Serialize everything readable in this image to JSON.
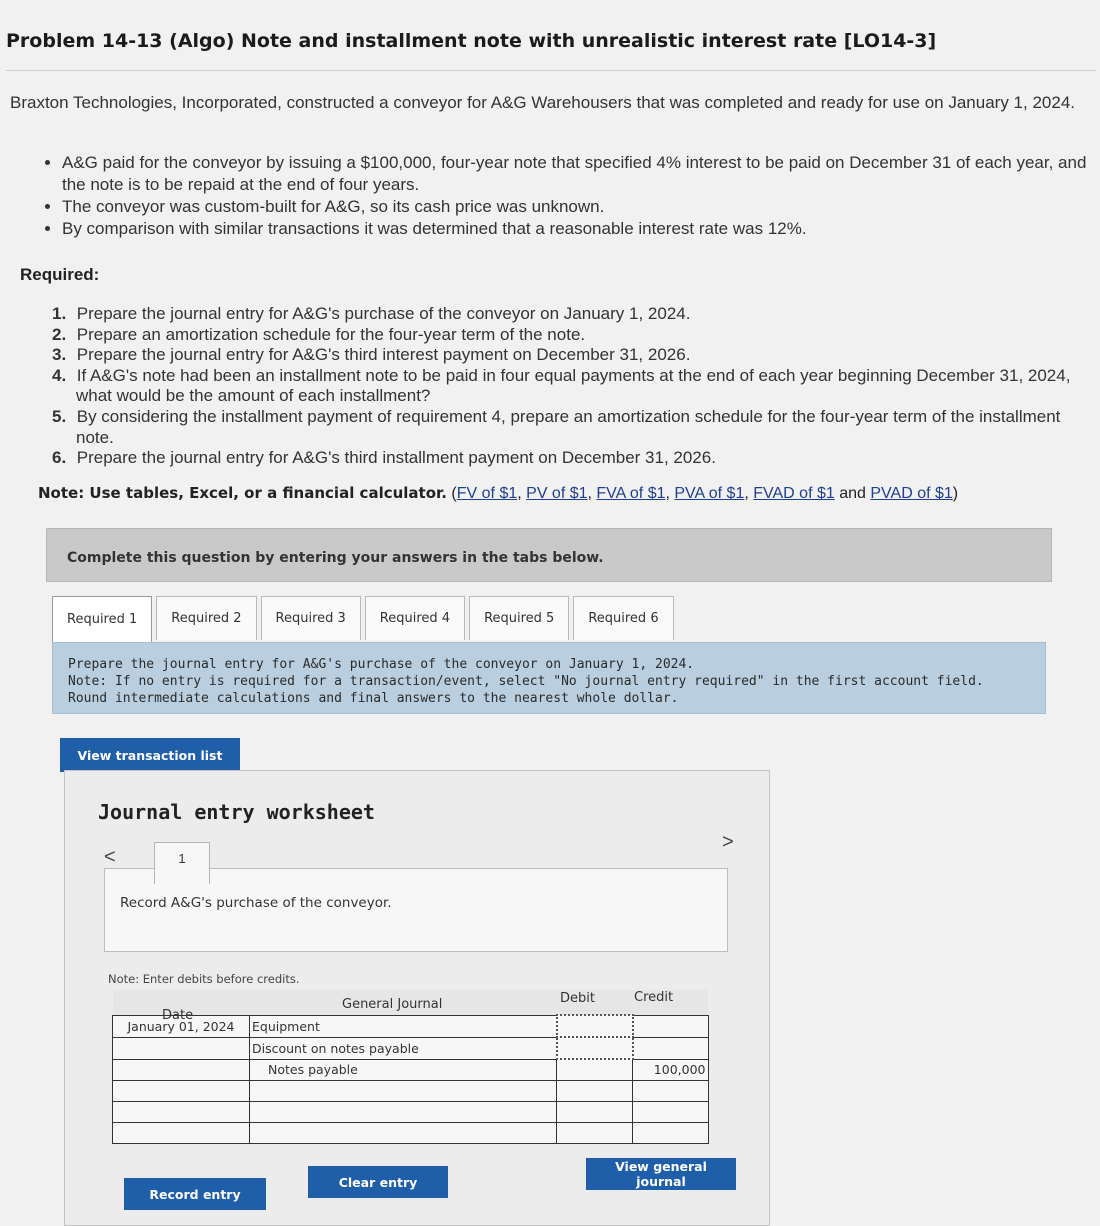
{
  "problem": {
    "title": "Problem 14-13 (Algo) Note and installment note with unrealistic interest rate [LO14-3]",
    "intro": "Braxton Technologies, Incorporated, constructed a conveyor for A&G Warehousers that was completed and ready for use on January 1, 2024.",
    "bullets": [
      "A&G paid for the conveyor by issuing a $100,000, four-year note that specified 4% interest to be paid on December 31 of each year, and the note is to be repaid at the end of four years.",
      "The conveyor was custom-built for A&G, so its cash price was unknown.",
      "By comparison with similar transactions it was determined that a reasonable interest rate was 12%."
    ],
    "required_heading": "Required:",
    "requirements": [
      {
        "num": "1.",
        "text": "Prepare the journal entry for A&G's purchase of the conveyor on January 1, 2024."
      },
      {
        "num": "2.",
        "text": "Prepare an amortization schedule for the four-year term of the note."
      },
      {
        "num": "3.",
        "text": "Prepare the journal entry for A&G's third interest payment on December 31, 2026."
      },
      {
        "num": "4.",
        "text": "If A&G's note had been an installment note to be paid in four equal payments at the end of each year beginning December 31, 2024, what would be the amount of each installment?"
      },
      {
        "num": "5.",
        "text": "By considering the installment payment of requirement 4, prepare an amortization schedule for the four-year term of the installment note."
      },
      {
        "num": "6.",
        "text": "Prepare the journal entry for A&G's third installment payment on December 31, 2026."
      }
    ],
    "note_label": "Note: Use tables, Excel, or a financial calculator.",
    "note_links": [
      "FV of $1",
      "PV of $1",
      "FVA of $1",
      "PVA of $1",
      "FVAD of $1",
      "PVAD of $1"
    ],
    "note_and": "and"
  },
  "complete_bar": "Complete this question by entering your answers in the tabs below.",
  "tabs": [
    "Required 1",
    "Required 2",
    "Required 3",
    "Required 4",
    "Required 5",
    "Required 6"
  ],
  "instructions": {
    "line1": "Prepare the journal entry for A&G's purchase of the conveyor on January 1, 2024.",
    "line2": "Note: If no entry is required for a transaction/event, select \"No journal entry required\" in the first account field. Round intermediate calculations and final answers to the nearest whole dollar."
  },
  "buttons": {
    "view_transaction_list": "View transaction list",
    "record_entry": "Record entry",
    "clear_entry": "Clear entry",
    "view_general_journal": "View general journal"
  },
  "worksheet": {
    "title": "Journal entry worksheet",
    "prev": "<",
    "next": ">",
    "page": "1",
    "record_text": "Record A&G's purchase of the conveyor.",
    "enter_note": "Note: Enter debits before credits.",
    "headers": {
      "date": "Date",
      "general_journal": "General Journal",
      "debit": "Debit",
      "credit": "Credit"
    },
    "rows": [
      {
        "date": "January 01, 2024",
        "account": "Equipment",
        "debit": "",
        "credit": ""
      },
      {
        "date": "",
        "account": "Discount on notes payable",
        "debit": "",
        "credit": ""
      },
      {
        "date": "",
        "account": "Notes payable",
        "debit": "",
        "credit": "100,000"
      },
      {
        "date": "",
        "account": "",
        "debit": "",
        "credit": ""
      },
      {
        "date": "",
        "account": "",
        "debit": "",
        "credit": ""
      },
      {
        "date": "",
        "account": "",
        "debit": "",
        "credit": ""
      }
    ]
  }
}
